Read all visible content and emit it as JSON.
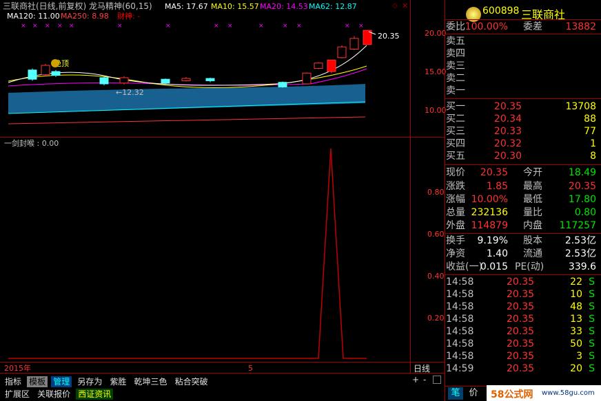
{
  "header": {
    "title": "三联商社(日线,前复权) 龙马精神(60,15)",
    "ma5_label": "MA5: 17.67",
    "ma10_label": "MA10: 15.57",
    "ma20_label": "MA20: 14.53",
    "ma62_label": "MA62: 12.87",
    "ma120_label": "MA120: 11.00",
    "ma250_label": "MA250: 8.98",
    "caishen_label": "财神: -"
  },
  "main_chart": {
    "y_ticks": [
      "20.00",
      "15.00",
      "10.00"
    ],
    "last_price_label": "20.35",
    "low_price_label": "12.32",
    "top_label": "绝顶",
    "candles": [
      {
        "o": 15.2,
        "c": 14.0,
        "h": 15.4,
        "l": 13.8
      },
      {
        "o": 14.6,
        "c": 15.8,
        "h": 16.0,
        "l": 14.4
      },
      {
        "o": 15.0,
        "c": 14.5,
        "h": 15.2,
        "l": 14.3
      },
      {
        "o": 14.2,
        "c": 13.4,
        "h": 14.3,
        "l": 13.2
      },
      {
        "o": 13.5,
        "c": 14.2,
        "h": 14.4,
        "l": 13.3
      },
      {
        "o": 14.0,
        "c": 13.5,
        "h": 14.1,
        "l": 13.4
      },
      {
        "o": 13.8,
        "c": 14.1,
        "h": 14.3,
        "l": 13.7
      },
      {
        "o": 14.1,
        "c": 13.8,
        "h": 14.2,
        "l": 13.6
      },
      {
        "o": 13.6,
        "c": 13.0,
        "h": 13.7,
        "l": 12.9
      },
      {
        "o": 13.4,
        "c": 14.8,
        "h": 14.9,
        "l": 13.4
      },
      {
        "o": 15.4,
        "c": 16.1,
        "h": 16.2,
        "l": 15.3
      },
      {
        "o": 15.0,
        "c": 16.5,
        "h": 16.5,
        "l": 14.8
      },
      {
        "o": 16.8,
        "c": 18.2,
        "h": 18.4,
        "l": 16.7
      },
      {
        "o": 17.9,
        "c": 19.3,
        "h": 19.6,
        "l": 17.8
      },
      {
        "o": 18.5,
        "c": 20.35,
        "h": 20.35,
        "l": 18.5
      }
    ]
  },
  "indicator": {
    "title": "一剑封喉 : 0.00",
    "y_ticks": [
      "0.80",
      "0.60",
      "0.40",
      "0.20"
    ],
    "x_label_year": "2015年",
    "x_label_month": "5",
    "values": [
      0,
      0,
      0,
      0,
      0,
      0,
      0,
      0,
      0,
      0,
      0,
      0,
      1,
      0,
      0
    ]
  },
  "right": {
    "code": "600898",
    "name": "三联商社",
    "webi_label": "委比",
    "webi_value": "100.00%",
    "weicha_label": "委差",
    "weicha_value": "13882",
    "sell": [
      "卖五",
      "卖四",
      "卖三",
      "卖二",
      "卖一"
    ],
    "buy": [
      {
        "label": "买一",
        "price": "20.35",
        "vol": "13708"
      },
      {
        "label": "买二",
        "price": "20.34",
        "vol": "88"
      },
      {
        "label": "买三",
        "price": "20.33",
        "vol": "77"
      },
      {
        "label": "买四",
        "price": "20.32",
        "vol": "1"
      },
      {
        "label": "买五",
        "price": "20.30",
        "vol": "8"
      }
    ],
    "stats": [
      {
        "l1": "现价",
        "v1": "20.35",
        "l2": "今开",
        "v2": "18.49"
      },
      {
        "l1": "涨跌",
        "v1": "1.85",
        "l2": "最高",
        "v2": "20.35"
      },
      {
        "l1": "涨幅",
        "v1": "10.00%",
        "l2": "最低",
        "v2": "17.80"
      },
      {
        "l1": "总量",
        "v1": "232136",
        "l2": "量比",
        "v2": "0.80"
      },
      {
        "l1": "外盘",
        "v1": "114879",
        "l2": "内盘",
        "v2": "117257"
      }
    ],
    "stats2": [
      {
        "l1": "换手",
        "v1": "9.19%",
        "l2": "股本",
        "v2": "2.53亿"
      },
      {
        "l1": "净资",
        "v1": "1.40",
        "l2": "流通",
        "v2": "2.53亿"
      },
      {
        "l1": "收益(一)",
        "v1": "0.015",
        "l2": "PE(动)",
        "v2": "339.6"
      }
    ],
    "ticks": [
      {
        "time": "14:58",
        "price": "20.35",
        "vol": "22",
        "flag": "S"
      },
      {
        "time": "14:58",
        "price": "20.35",
        "vol": "10",
        "flag": "S"
      },
      {
        "time": "14:58",
        "price": "20.35",
        "vol": "48",
        "flag": "S"
      },
      {
        "time": "14:58",
        "price": "20.35",
        "vol": "13",
        "flag": "S"
      },
      {
        "time": "14:58",
        "price": "20.35",
        "vol": "33",
        "flag": "S"
      },
      {
        "time": "14:58",
        "price": "20.35",
        "vol": "50",
        "flag": "S"
      },
      {
        "time": "14:58",
        "price": "20.35",
        "vol": "3",
        "flag": "S"
      },
      {
        "time": "14:59",
        "price": "20.35",
        "vol": "20",
        "flag": "S"
      }
    ],
    "bottom_tabs": [
      "笔",
      "价"
    ]
  },
  "period_label": "日线",
  "tabs": [
    "指标",
    "模板",
    "管理",
    "另存为",
    "紫胜",
    "乾坤三色",
    "粘合突破"
  ],
  "tabs2": [
    "扩展区",
    "关联报价",
    "西证资讯"
  ],
  "watermark": "58公式网",
  "watermark_url": "www.58gu.com",
  "logo_text": "58公式网"
}
